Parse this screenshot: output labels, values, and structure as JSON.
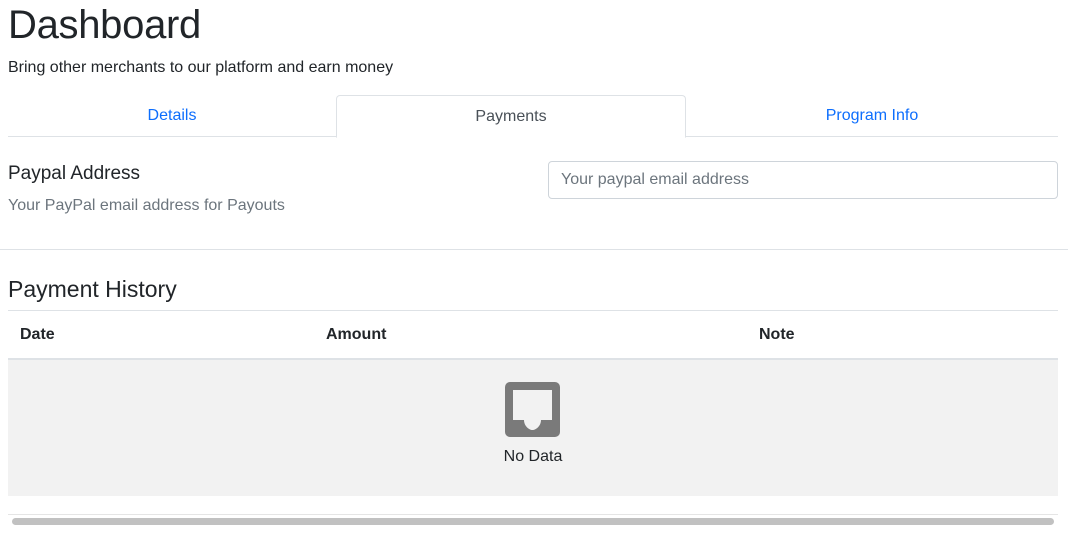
{
  "header": {
    "title": "Dashboard",
    "subtitle": "Bring other merchants to our platform and earn money"
  },
  "tabs": [
    {
      "label": "Details",
      "active": false
    },
    {
      "label": "Payments",
      "active": true
    },
    {
      "label": "Program Info",
      "active": false
    }
  ],
  "paypal": {
    "title": "Paypal Address",
    "description": "Your PayPal email address for Payouts",
    "input_value": "",
    "input_placeholder": "Your paypal email address"
  },
  "payment_history": {
    "title": "Payment History",
    "columns": [
      "Date",
      "Amount",
      "Note"
    ],
    "rows": [],
    "empty_text": "No Data",
    "empty_icon": "inbox-icon"
  },
  "colors": {
    "link": "#0d6efd",
    "muted": "#6c757d",
    "empty_bg": "#f2f2f2",
    "icon": "#7a7a7a"
  }
}
